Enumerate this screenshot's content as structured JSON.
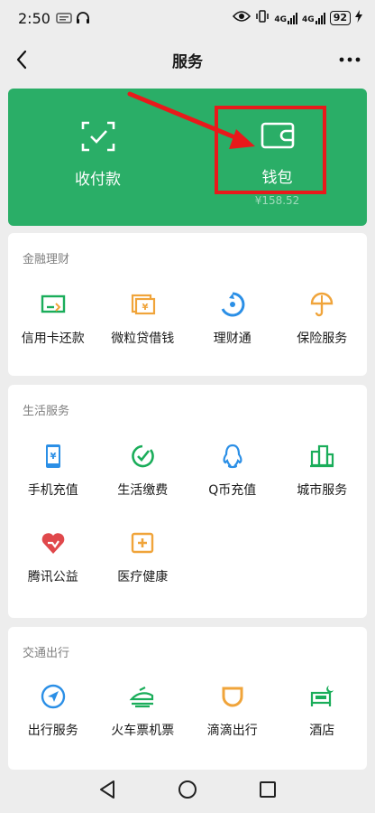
{
  "status_bar": {
    "time": "2:50",
    "battery": "92",
    "network_a": "4G",
    "network_b": "4G"
  },
  "nav": {
    "title": "服务"
  },
  "banner": {
    "pay_label": "收付款",
    "wallet_label": "钱包",
    "wallet_balance": "¥158.52"
  },
  "finance": {
    "title": "金融理财",
    "items": [
      {
        "label": "信用卡还款",
        "icon": "credit-card-repay-icon"
      },
      {
        "label": "微粒贷借钱",
        "icon": "loan-icon"
      },
      {
        "label": "理财通",
        "icon": "wealth-icon"
      },
      {
        "label": "保险服务",
        "icon": "insurance-icon"
      }
    ]
  },
  "life": {
    "title": "生活服务",
    "items": [
      {
        "label": "手机充值",
        "icon": "phone-topup-icon"
      },
      {
        "label": "生活缴费",
        "icon": "utility-bill-icon"
      },
      {
        "label": "Q币充值",
        "icon": "qcoin-icon"
      },
      {
        "label": "城市服务",
        "icon": "city-service-icon"
      },
      {
        "label": "腾讯公益",
        "icon": "charity-icon"
      },
      {
        "label": "医疗健康",
        "icon": "medical-icon"
      }
    ]
  },
  "transport": {
    "title": "交通出行",
    "items": [
      {
        "label": "出行服务",
        "icon": "travel-icon"
      },
      {
        "label": "火车票机票",
        "icon": "train-plane-icon"
      },
      {
        "label": "滴滴出行",
        "icon": "didi-icon"
      },
      {
        "label": "酒店",
        "icon": "hotel-icon"
      }
    ]
  },
  "colors": {
    "brand_green": "#2aae67",
    "highlight_red": "#e8191b",
    "icon_green": "#1aad5a",
    "icon_orange": "#f0a43a",
    "icon_blue": "#2b8fe6",
    "icon_red": "#e0484b"
  }
}
